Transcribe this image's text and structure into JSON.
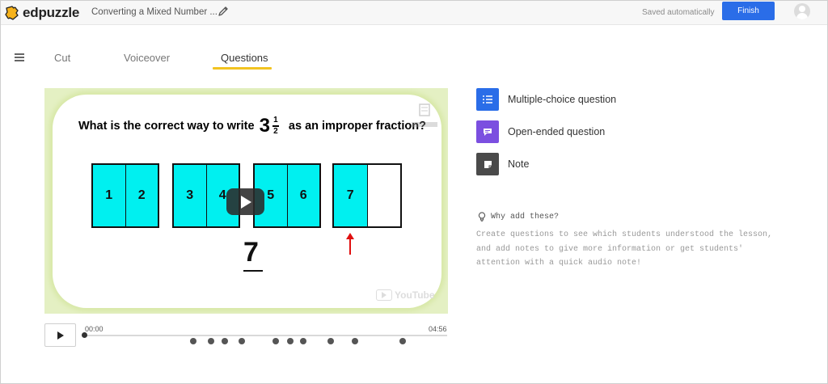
{
  "app": {
    "logo_text": "edpuzzle"
  },
  "header": {
    "lesson_title": "Converting a Mixed Number ...",
    "saved_status": "Saved automatically",
    "finish_label": "Finish",
    "accent": "#2a6de8"
  },
  "tabs": [
    {
      "label": "Cut",
      "active": false
    },
    {
      "label": "Voiceover",
      "active": false
    },
    {
      "label": "Questions",
      "active": true
    }
  ],
  "video": {
    "question_before": "What is the correct way to write",
    "mixed_whole": "3",
    "mixed_num": "1",
    "mixed_den": "2",
    "question_after": "as an improper fraction?",
    "boxes": [
      {
        "cells": [
          "1",
          "2"
        ]
      },
      {
        "cells": [
          "3",
          "4"
        ]
      },
      {
        "cells": [
          "5",
          "6"
        ]
      },
      {
        "cells": [
          "7",
          ""
        ]
      }
    ],
    "answer_numerator": "7",
    "youtube_label": "YouTube"
  },
  "player": {
    "current_time": "00:00",
    "duration": "04:56",
    "marker_count": 10
  },
  "options": [
    {
      "label": "Multiple-choice question",
      "icon": "list-icon",
      "color": "#2a6de8"
    },
    {
      "label": "Open-ended question",
      "icon": "comment-icon",
      "color": "#7b4fe0"
    },
    {
      "label": "Note",
      "icon": "note-icon",
      "color": "#4a4a4a"
    }
  ],
  "help": {
    "title": "Why add these?",
    "body": "Create questions to see which students understood the lesson, and add notes to give more information or get students' attention with a quick audio note!"
  }
}
